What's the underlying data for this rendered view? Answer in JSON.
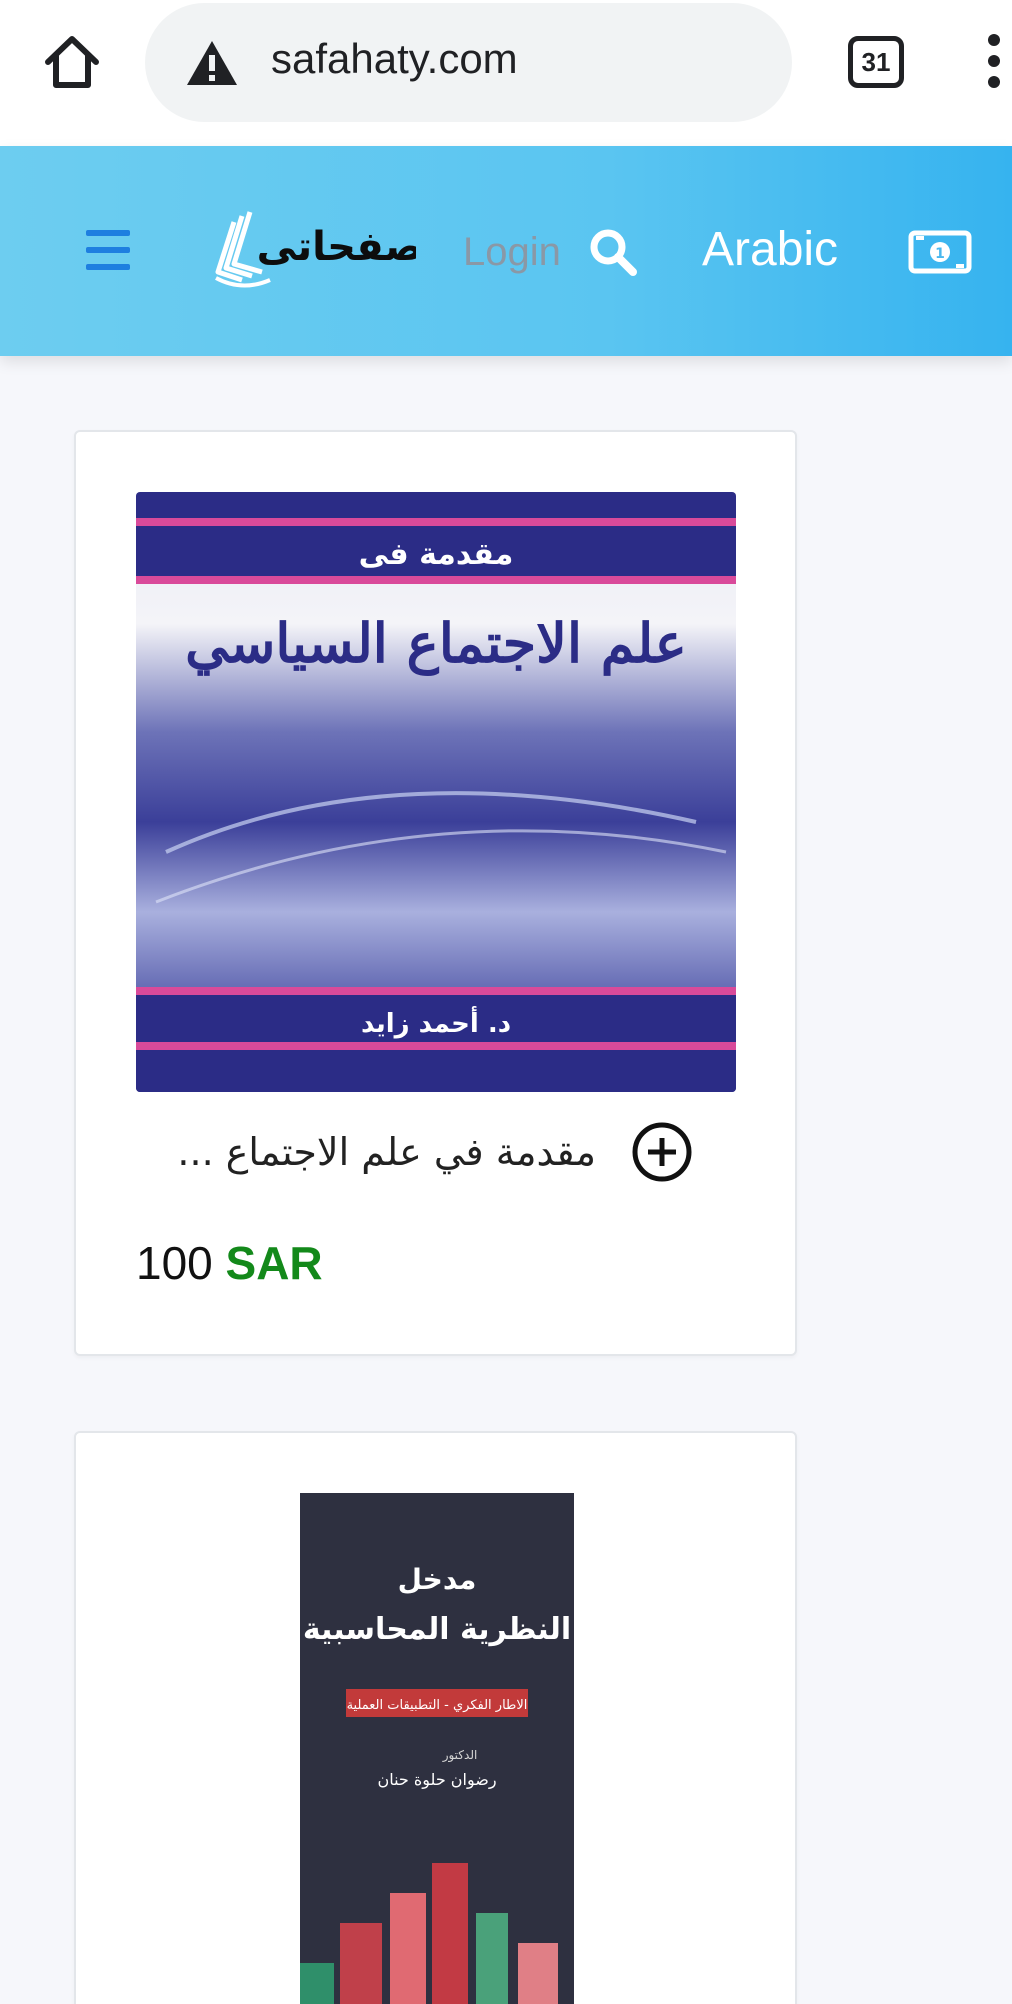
{
  "browser": {
    "url": "safahaty.com",
    "tab_count": "31"
  },
  "header": {
    "logo_text": "صفحاتى",
    "login_label": "Login",
    "language_label": "Arabic",
    "colors": {
      "header_bg": "#5ac5f1",
      "menu_icon": "#1e7fe0",
      "login_text": "#8a98a6"
    }
  },
  "products": [
    {
      "cover": {
        "top_label": "مقدمة فى",
        "main_title": "علم الاجتماع السياسي",
        "author": "د. أحمد زايد"
      },
      "title": "مقدمة في علم الاجتماع ...",
      "price": "100",
      "currency": "SAR"
    },
    {
      "cover": {
        "line1": "مدخل",
        "line2": "النظرية المحاسبية",
        "banner": "الاطار الفكري - التطبيقات العملية",
        "author_prefix": "الدكتور",
        "author": "رضوان حلوة حنان"
      }
    }
  ],
  "colors": {
    "price_currency": "#13891a",
    "page_bg": "#f6f7fb"
  },
  "icons": [
    "home-icon",
    "warning-icon",
    "tab-switcher-icon",
    "more-menu-icon",
    "hamburger-icon",
    "search-icon",
    "money-icon",
    "add-circle-icon"
  ]
}
